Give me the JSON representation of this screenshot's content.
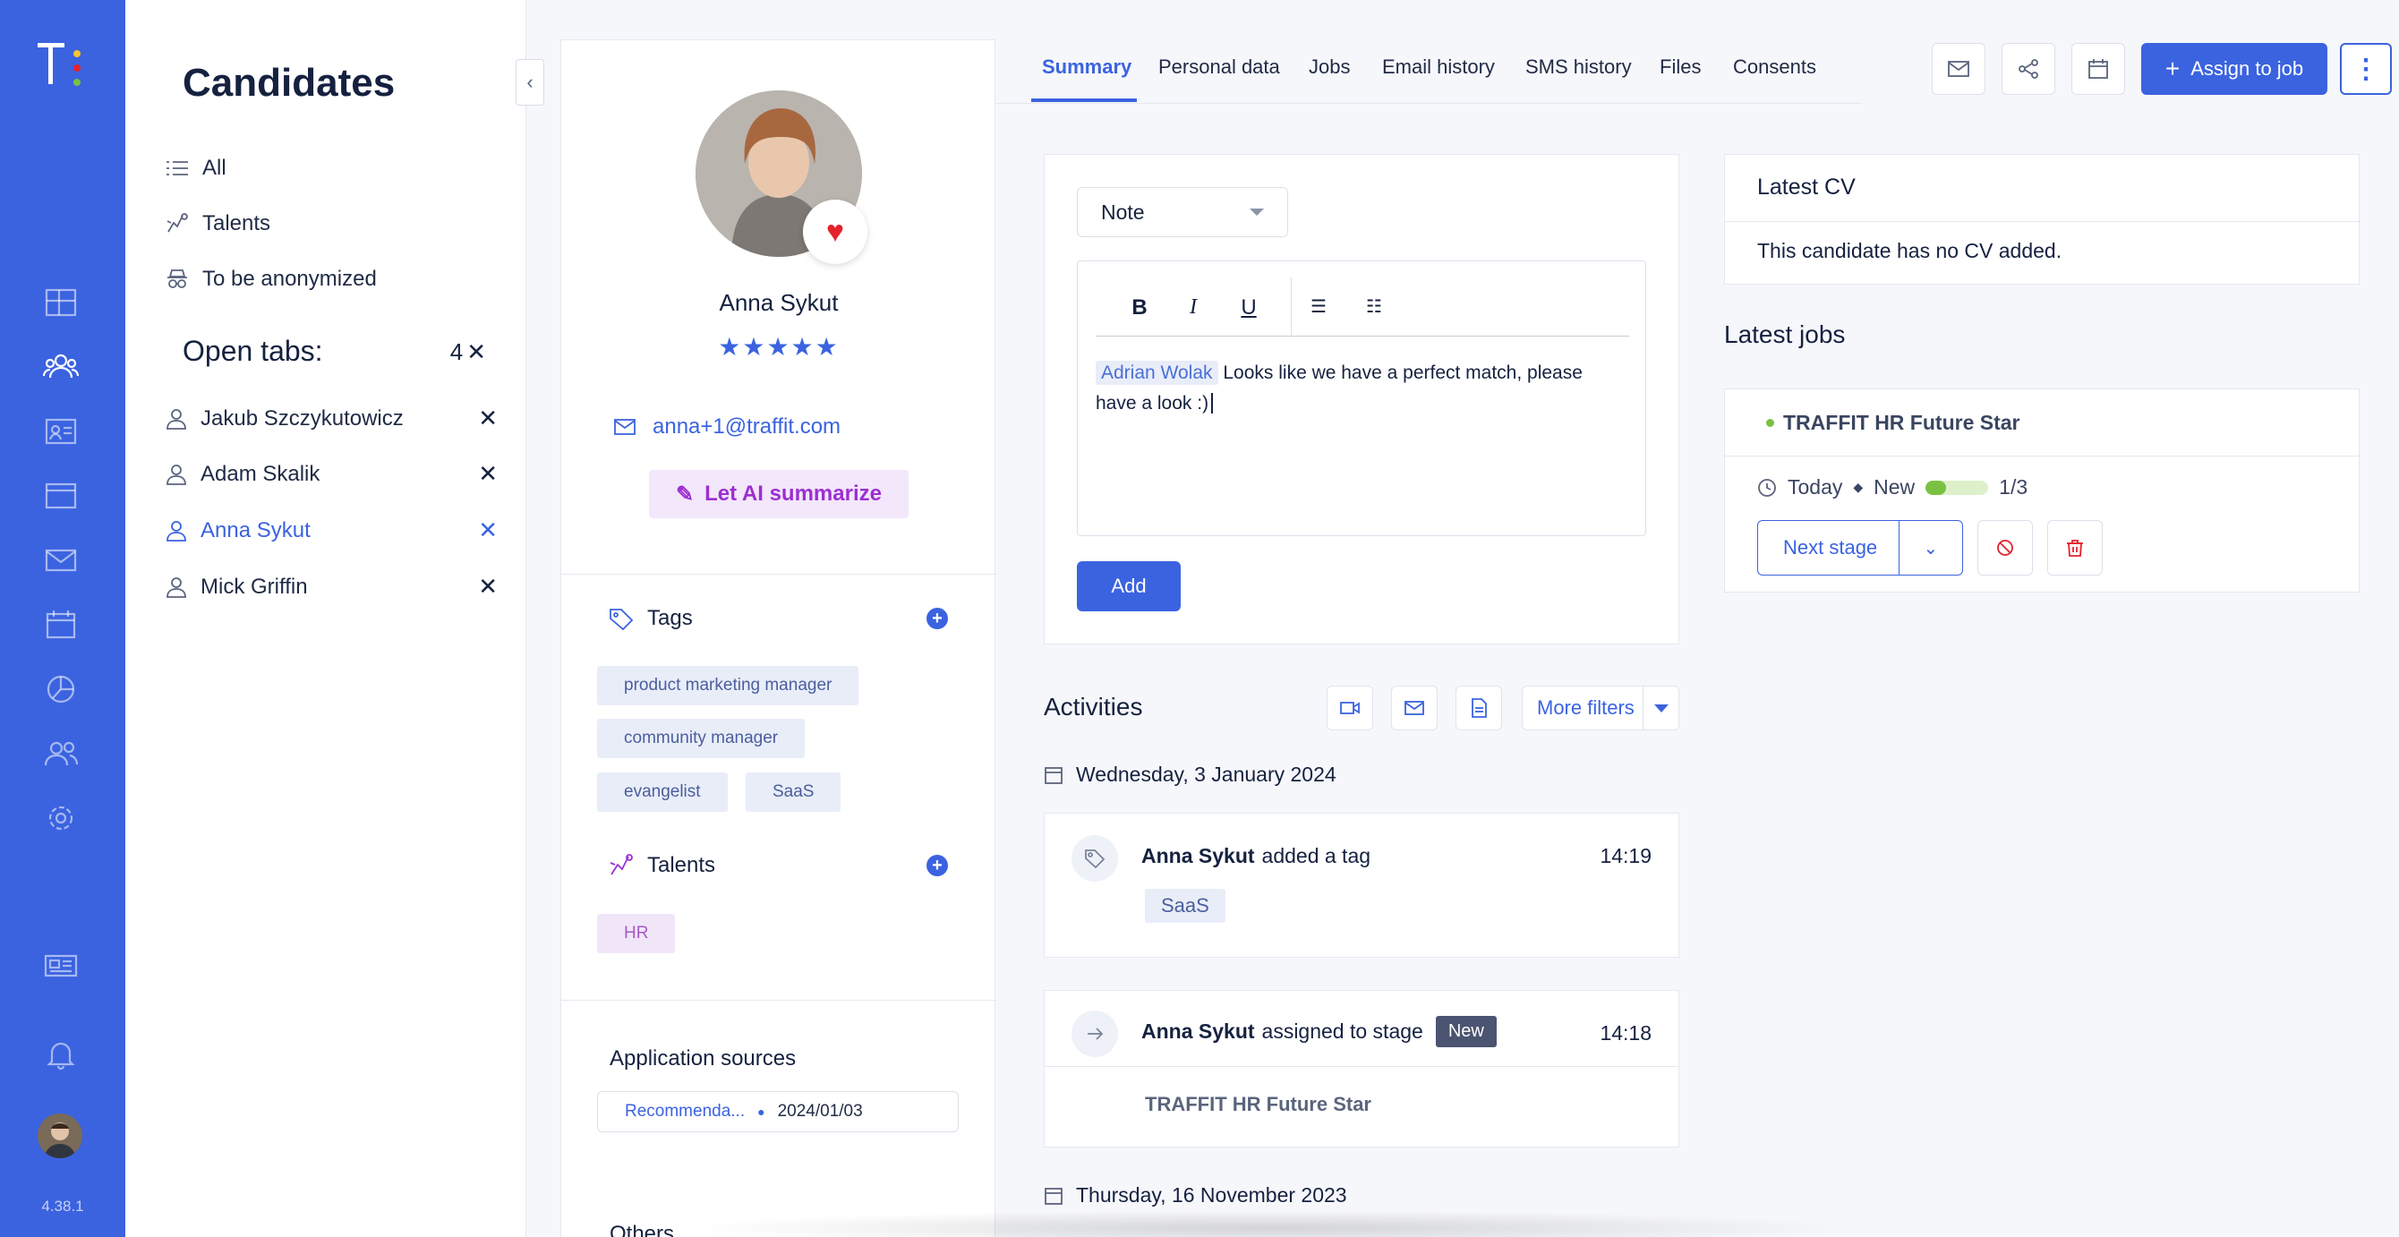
{
  "app": {
    "version": "4.38.1"
  },
  "candidates": {
    "title": "Candidates",
    "filters": [
      {
        "label": "All",
        "icon": "list-icon"
      },
      {
        "label": "Talents",
        "icon": "talent-icon"
      },
      {
        "label": "To be anonymized",
        "icon": "anonymous-icon"
      }
    ],
    "open_tabs_label": "Open tabs:",
    "open_tabs_count": "4",
    "open_tabs": [
      {
        "name": "Jakub Szczykutowicz",
        "active": false
      },
      {
        "name": "Adam Skalik",
        "active": false
      },
      {
        "name": "Anna Sykut",
        "active": true
      },
      {
        "name": "Mick Griffin",
        "active": false
      }
    ]
  },
  "profile": {
    "name": "Anna Sykut",
    "rating_stars": "★★★★★",
    "email": "anna+1@traffit.com",
    "ai_button": "Let AI summarize",
    "tags_title": "Tags",
    "tags": [
      "product marketing manager",
      "community manager",
      "evangelist",
      "SaaS"
    ],
    "talents_title": "Talents",
    "talents": [
      "HR"
    ],
    "application_sources_title": "Application sources",
    "application_source": {
      "source": "Recommenda...",
      "date": "2024/01/03"
    },
    "others_title": "Others"
  },
  "tabs": [
    "Summary",
    "Personal data",
    "Jobs",
    "Email history",
    "SMS history",
    "Files",
    "Consents"
  ],
  "assign_button": "Assign to job",
  "note": {
    "type": "Note",
    "mention": "Adrian Wolak",
    "text": "Looks like we have a perfect match, please have a look :)",
    "add_button": "Add"
  },
  "activities": {
    "title": "Activities",
    "more_filters": "More filters",
    "groups": [
      {
        "date": "Wednesday, 3 January 2024",
        "items": [
          {
            "actor": "Anna Sykut",
            "action": "added a tag",
            "time": "14:19",
            "chip": "SaaS"
          },
          {
            "actor": "Anna Sykut",
            "action": "assigned to stage",
            "stage": "New",
            "time": "14:18",
            "job": "TRAFFIT HR Future Star"
          }
        ]
      },
      {
        "date": "Thursday, 16 November 2023"
      }
    ]
  },
  "latest_cv": {
    "title": "Latest CV",
    "message": "This candidate has no CV added."
  },
  "latest_jobs": {
    "title": "Latest jobs",
    "job": {
      "name": "TRAFFIT HR Future Star",
      "when": "Today",
      "stage": "New",
      "progress_label": "1/3",
      "progress_fraction": 0.33,
      "next_stage": "Next stage"
    }
  },
  "colors": {
    "brand": "#3b63e0",
    "danger": "#e5212d",
    "success": "#7ac143",
    "ai_accent": "#9c2fd1"
  }
}
